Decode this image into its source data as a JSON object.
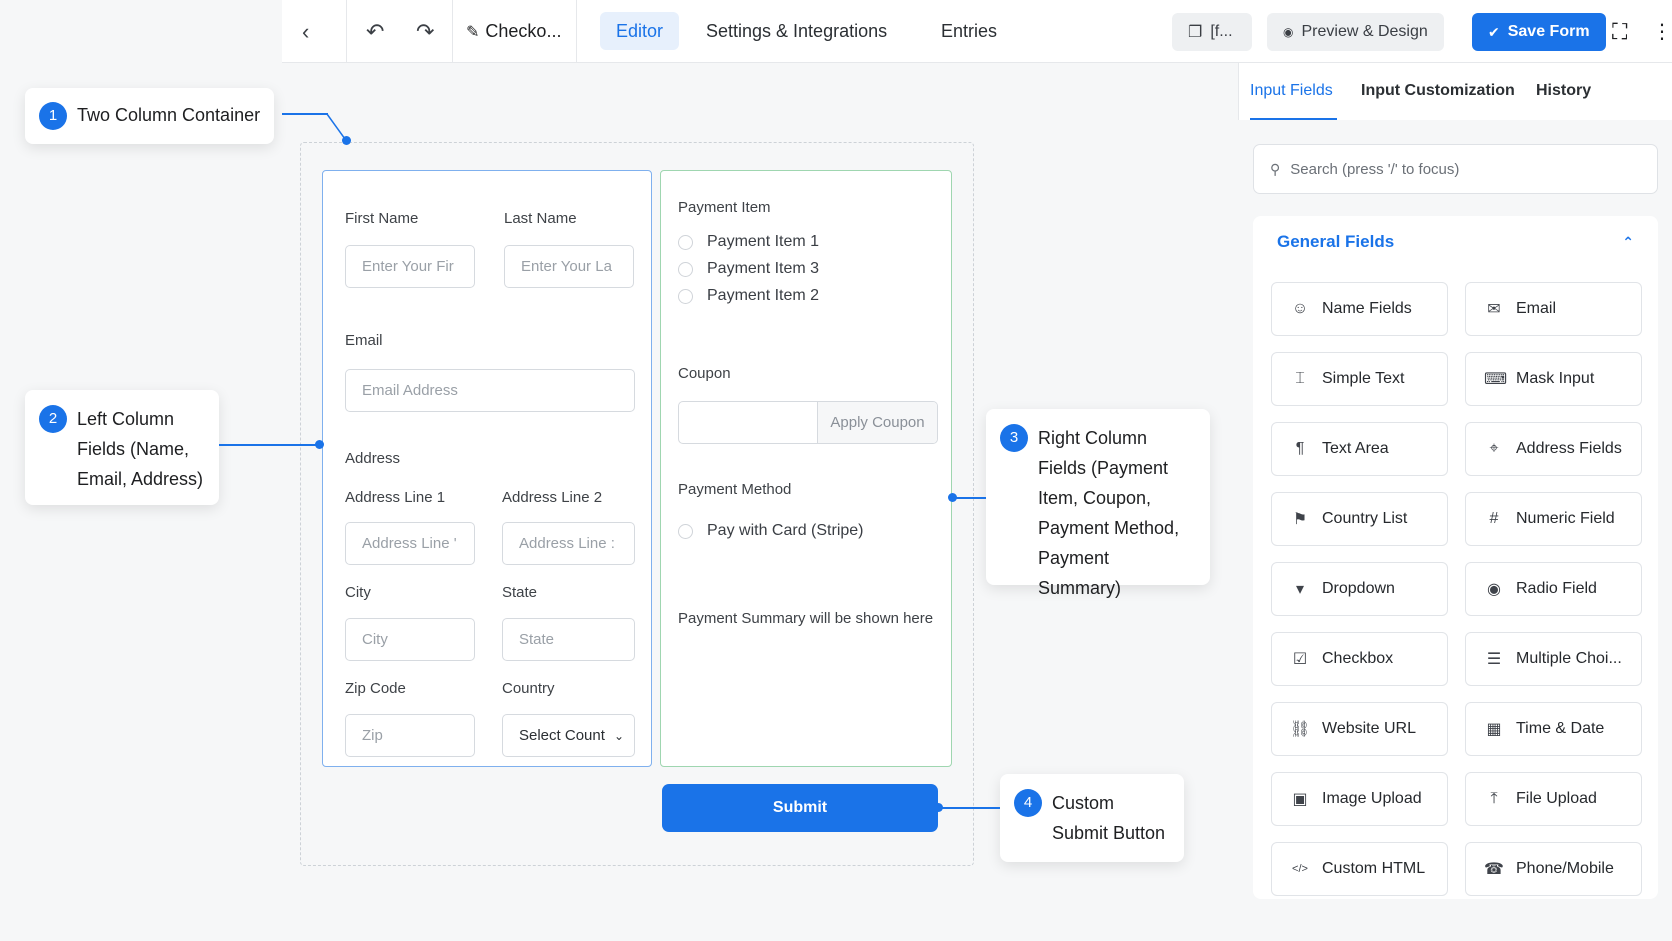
{
  "topbar": {
    "form_name": "Checko...",
    "tabs": [
      {
        "label": "Editor",
        "active": true
      },
      {
        "label": "Settings & Integrations",
        "active": false
      },
      {
        "label": "Entries",
        "active": false
      }
    ],
    "shortcode_label": "[f...",
    "preview_label": "Preview & Design",
    "save_label": "Save Form"
  },
  "form": {
    "first_name_label": "First Name",
    "first_name_placeholder": "Enter Your Fir",
    "last_name_label": "Last Name",
    "last_name_placeholder": "Enter Your La",
    "email_label": "Email",
    "email_placeholder": "Email Address",
    "address_label": "Address",
    "address1_label": "Address Line 1",
    "address1_placeholder": "Address Line '",
    "address2_label": "Address Line 2",
    "address2_placeholder": "Address Line :",
    "city_label": "City",
    "city_placeholder": "City",
    "state_label": "State",
    "state_placeholder": "State",
    "zip_label": "Zip Code",
    "zip_placeholder": "Zip",
    "country_label": "Country",
    "country_value": "Select Count",
    "payment_item_label": "Payment Item",
    "payment_items": [
      "Payment Item 1",
      "Payment Item 3",
      "Payment Item 2"
    ],
    "coupon_label": "Coupon",
    "apply_coupon_label": "Apply Coupon",
    "payment_method_label": "Payment Method",
    "payment_method_option": "Pay with Card (Stripe)",
    "payment_summary_text": "Payment Summary will be shown here",
    "submit_label": "Submit"
  },
  "callouts": [
    {
      "number": "1",
      "lines": [
        "Two Column Container"
      ]
    },
    {
      "number": "2",
      "lines": [
        "Left Column",
        "Fields (Name,",
        "Email, Address)"
      ]
    },
    {
      "number": "3",
      "lines": [
        "Right Column",
        "Fields (Payment",
        "Item, Coupon,",
        "Payment Method,",
        "Payment Summary)"
      ]
    },
    {
      "number": "4",
      "lines": [
        "Custom",
        "Submit Button"
      ]
    }
  ],
  "panel": {
    "tabs": [
      {
        "label": "Input Fields",
        "active": true
      },
      {
        "label": "Input Customization",
        "active": false
      },
      {
        "label": "History",
        "active": false
      }
    ],
    "search_placeholder": "Search (press '/' to focus)",
    "section_title": "General Fields",
    "fields": [
      {
        "label": "Name Fields",
        "icon": "user-icon"
      },
      {
        "label": "Email",
        "icon": "envelope-icon"
      },
      {
        "label": "Simple Text",
        "icon": "text-cursor-icon"
      },
      {
        "label": "Mask Input",
        "icon": "keyboard-icon"
      },
      {
        "label": "Text Area",
        "icon": "paragraph-icon"
      },
      {
        "label": "Address Fields",
        "icon": "map-pin-icon"
      },
      {
        "label": "Country List",
        "icon": "flag-icon"
      },
      {
        "label": "Numeric Field",
        "icon": "hash-icon"
      },
      {
        "label": "Dropdown",
        "icon": "dropdown-icon"
      },
      {
        "label": "Radio Field",
        "icon": "radio-icon"
      },
      {
        "label": "Checkbox",
        "icon": "checkbox-icon"
      },
      {
        "label": "Multiple Choi...",
        "icon": "list-icon"
      },
      {
        "label": "Website URL",
        "icon": "link-icon"
      },
      {
        "label": "Time & Date",
        "icon": "calendar-icon"
      },
      {
        "label": "Image Upload",
        "icon": "image-icon"
      },
      {
        "label": "File Upload",
        "icon": "upload-icon"
      },
      {
        "label": "Custom HTML",
        "icon": "code-icon"
      },
      {
        "label": "Phone/Mobile",
        "icon": "phone-icon"
      }
    ]
  },
  "colors": {
    "accent": "#1a73e8",
    "left_column_border": "#7fb0ee",
    "right_column_border": "#9fd6b0"
  }
}
